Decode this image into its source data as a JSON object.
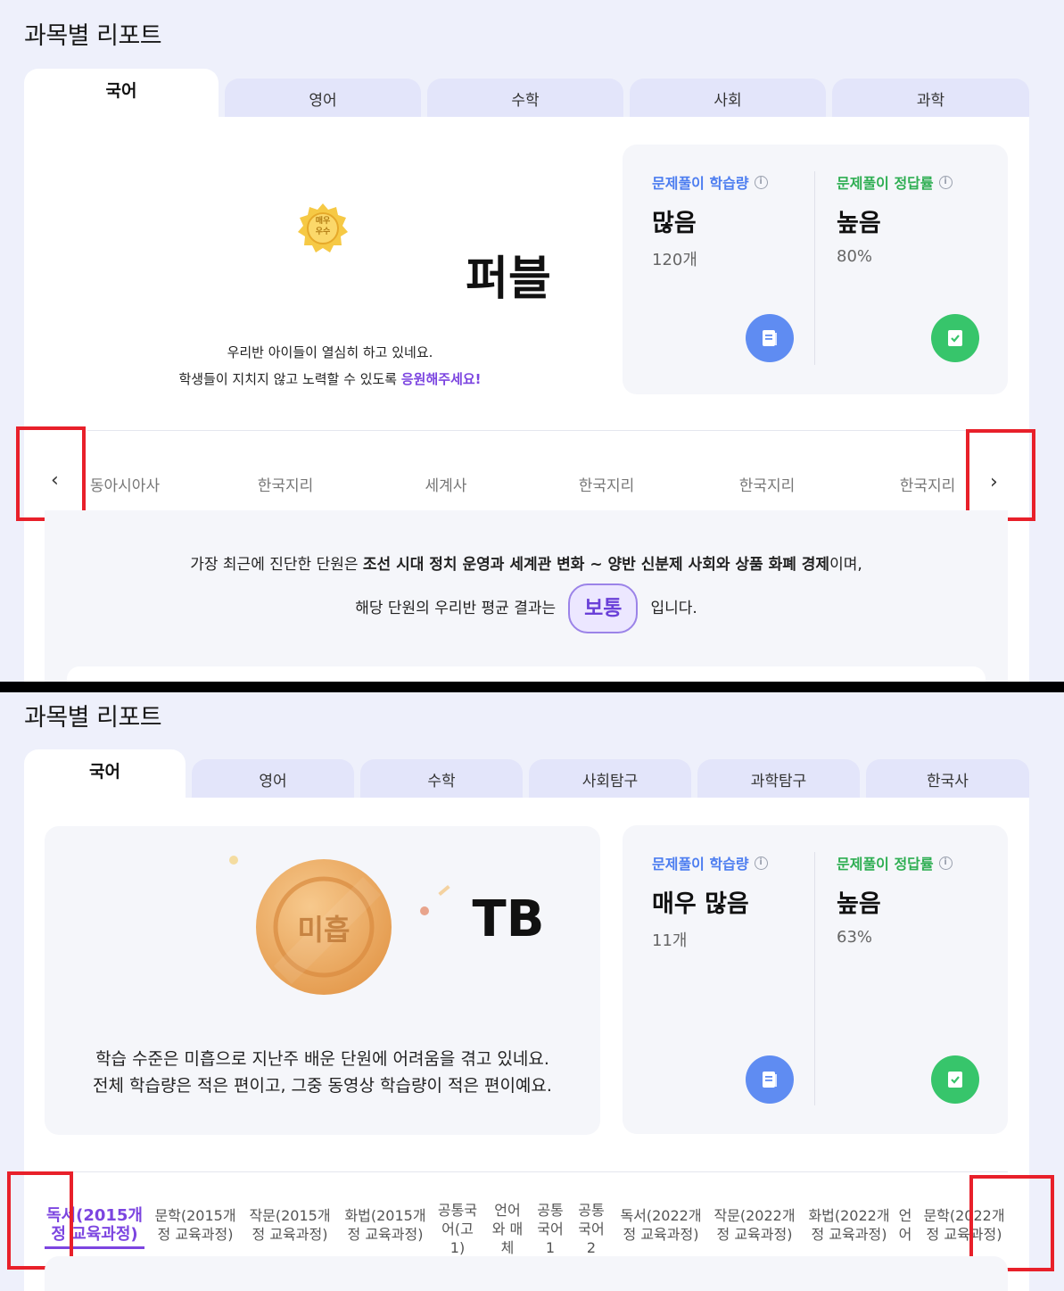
{
  "top": {
    "title": "과목별 리포트",
    "tabs": [
      "국어",
      "영어",
      "수학",
      "사회",
      "과학"
    ],
    "medal_text": [
      "매우",
      "우수"
    ],
    "name": "퍼블",
    "message_line1": "우리반 아이들이 열심히 하고 있네요.",
    "message_line2_prefix": "학생들이 지치지 않고 노력할 수 있도록 ",
    "message_line2_highlight": "응원해주세요!",
    "stats": {
      "amount_label": "문제풀이 학습량",
      "amount_value": "많음",
      "amount_count": "120개",
      "accuracy_label": "문제풀이 정답률",
      "accuracy_value": "높음",
      "accuracy_percent": "80%"
    },
    "units": [
      "동아시아사",
      "한국지리",
      "세계사",
      "한국지리",
      "한국지리",
      "한국지리"
    ],
    "summary_prefix": "가장 최근에 진단한 단원은 ",
    "summary_unit": "조선 시대 정치 운영과 세계관 변화 ~ 양반 신분제 사회와 상품 화폐 경제",
    "summary_suffix": "이며,",
    "result_prefix": "해당 단원의 우리반 평균 결과는",
    "result_badge": "보통",
    "result_suffix": "입니다."
  },
  "bottom": {
    "title": "과목별 리포트",
    "tabs": [
      "국어",
      "영어",
      "수학",
      "사회탐구",
      "과학탐구",
      "한국사"
    ],
    "medal_text": "미흡",
    "name": "TB",
    "message_line1": "학습 수준은 미흡으로 지난주 배운 단원에 어려움을 겪고 있네요.",
    "message_line2": "전체 학습량은 적은 편이고, 그중 동영상 학습량이 적은 편이예요.",
    "stats": {
      "amount_label": "문제풀이 학습량",
      "amount_value": "매우 많음",
      "amount_count": "11개",
      "accuracy_label": "문제풀이 정답률",
      "accuracy_value": "높음",
      "accuracy_percent": "63%"
    },
    "subtabs": [
      [
        "독서(2015개",
        "정 교육과정)"
      ],
      [
        "문학(2015개",
        "정 교육과정)"
      ],
      [
        "작문(2015개",
        "정 교육과정)"
      ],
      [
        "화법(2015개",
        "정 교육과정)"
      ],
      [
        "공통국",
        "어(고",
        "1)"
      ],
      [
        "언어",
        "와 매",
        "체"
      ],
      [
        "공통",
        "국어",
        "1"
      ],
      [
        "공통",
        "국어",
        "2"
      ],
      [
        "독서(2022개",
        "정 교육과정)"
      ],
      [
        "작문(2022개",
        "정 교육과정)"
      ],
      [
        "화법(2022개",
        "정 교육과정)"
      ],
      [
        "언",
        "어"
      ],
      [
        "문학(2022개",
        "정 교육과정)"
      ]
    ]
  },
  "colors": {
    "accent_purple": "#7c45e0",
    "blue": "#4c7df0",
    "green": "#2eae52",
    "highlight_red": "#e8202a"
  }
}
